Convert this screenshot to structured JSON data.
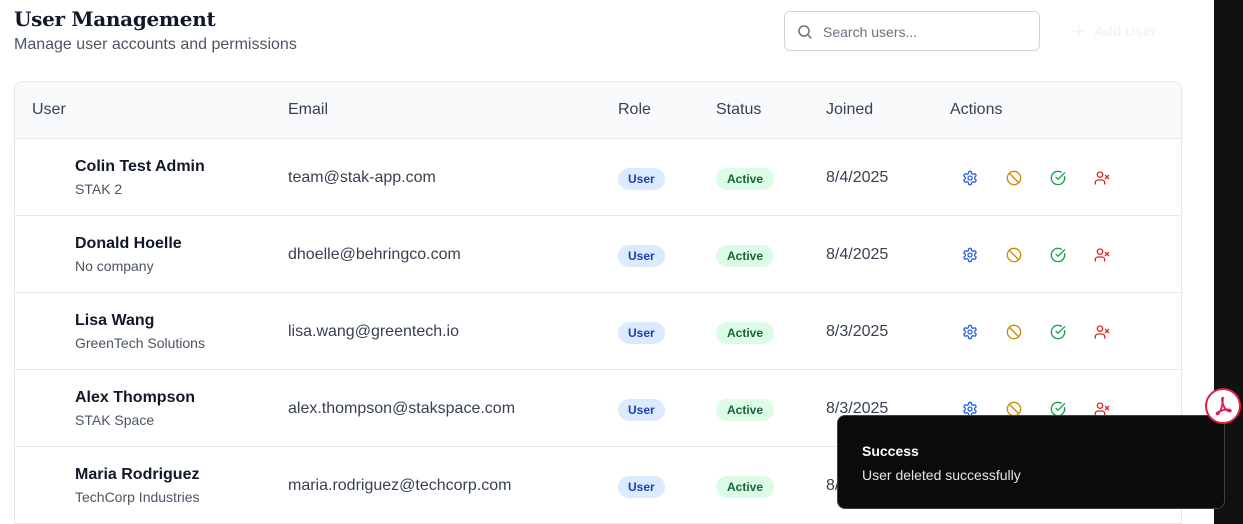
{
  "header": {
    "title": "User Management",
    "subtitle": "Manage user accounts and permissions",
    "search_placeholder": "Search users...",
    "search_value": "",
    "add_user_label": "Add User"
  },
  "table": {
    "columns": [
      "User",
      "Email",
      "Role",
      "Status",
      "Joined",
      "Actions"
    ],
    "rows": [
      {
        "name": "Colin Test Admin",
        "company": "STAK 2",
        "email": "team@stak-app.com",
        "role": "User",
        "status": "Active",
        "joined": "8/4/2025"
      },
      {
        "name": "Donald Hoelle",
        "company": "No company",
        "email": "dhoelle@behringco.com",
        "role": "User",
        "status": "Active",
        "joined": "8/4/2025"
      },
      {
        "name": "Lisa Wang",
        "company": "GreenTech Solutions",
        "email": "lisa.wang@greentech.io",
        "role": "User",
        "status": "Active",
        "joined": "8/3/2025"
      },
      {
        "name": "Alex Thompson",
        "company": "STAK Space",
        "email": "alex.thompson@stakspace.com",
        "role": "User",
        "status": "Active",
        "joined": "8/3/2025"
      },
      {
        "name": "Maria Rodriguez",
        "company": "TechCorp Industries",
        "email": "maria.rodriguez@techcorp.com",
        "role": "User",
        "status": "Active",
        "joined": "8/3/2025"
      }
    ],
    "action_icons": [
      "gear-icon",
      "ban-icon",
      "check-circle-icon",
      "user-remove-icon"
    ]
  },
  "toast": {
    "title": "Success",
    "message": "User deleted successfully"
  },
  "colors": {
    "role_badge_bg": "#dbeafe",
    "role_badge_text": "#1e40af",
    "status_badge_bg": "#dcfce7",
    "status_badge_text": "#166534",
    "action_settings": "#2563eb",
    "action_suspend": "#ca8a04",
    "action_activate": "#16a34a",
    "action_delete": "#dc2626",
    "toast_bg": "#0b0b0b"
  }
}
